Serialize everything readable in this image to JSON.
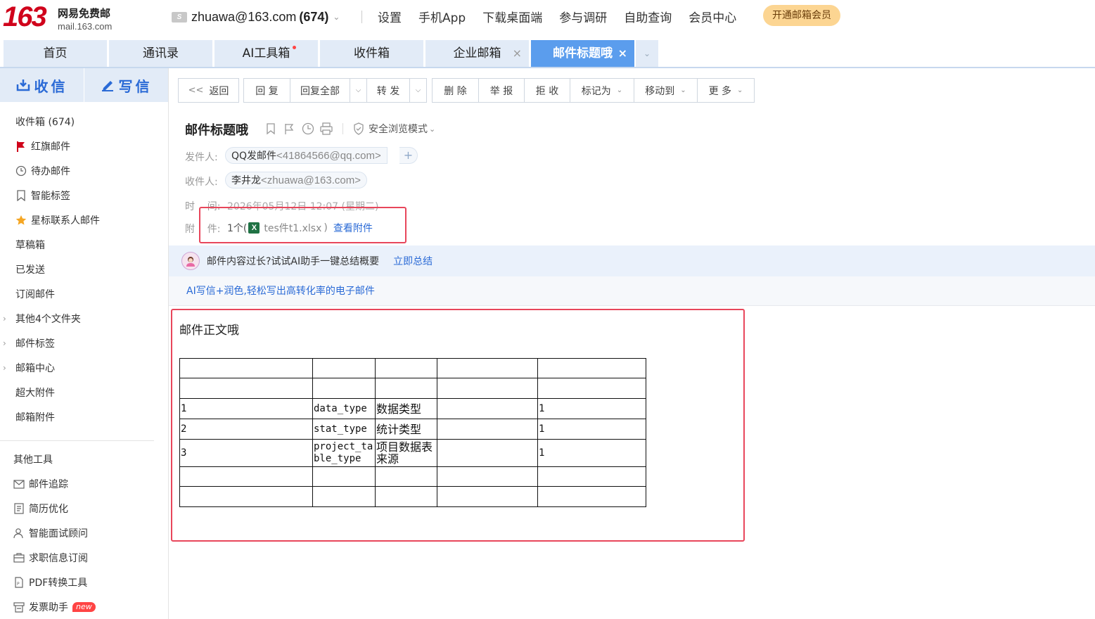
{
  "brand": {
    "logo_number": "163",
    "logo_cn": "网易免费邮",
    "logo_url": "mail.163.com"
  },
  "account": {
    "email": "zhuawa@163.com",
    "unread": "(674)"
  },
  "topnav": [
    "设置",
    "手机App",
    "下载桌面端",
    "参与调研",
    "自助查询",
    "会员中心"
  ],
  "vip_button": "开通邮箱会员",
  "tabs": [
    {
      "label": "首页"
    },
    {
      "label": "通讯录"
    },
    {
      "label": "AI工具箱"
    },
    {
      "label": "收件箱"
    },
    {
      "label": "企业邮箱"
    },
    {
      "label": "邮件标题哦"
    }
  ],
  "sidebar": {
    "receive": "收信",
    "compose": "写信",
    "folders": [
      {
        "label": "收件箱 (674)",
        "icon": "inbox"
      },
      {
        "label": "红旗邮件",
        "icon": "red-flag-icon"
      },
      {
        "label": "待办邮件",
        "icon": "clock-icon"
      },
      {
        "label": "智能标签",
        "icon": "bookmark-icon"
      },
      {
        "label": "星标联系人邮件",
        "icon": "star-icon"
      },
      {
        "label": "草稿箱"
      },
      {
        "label": "已发送"
      },
      {
        "label": "订阅邮件"
      },
      {
        "label": "其他4个文件夹",
        "icon": "expand-arrow"
      },
      {
        "label": "邮件标签",
        "icon": "expand-arrow"
      },
      {
        "label": "邮箱中心",
        "icon": "expand-arrow"
      },
      {
        "label": "超大附件"
      },
      {
        "label": "邮箱附件"
      }
    ],
    "tools_title": "其他工具",
    "tools": [
      {
        "label": "邮件追踪",
        "icon": "mail-track-icon"
      },
      {
        "label": "简历优化",
        "icon": "resume-icon"
      },
      {
        "label": "智能面试顾问",
        "icon": "interview-icon"
      },
      {
        "label": "求职信息订阅",
        "icon": "briefcase-icon"
      },
      {
        "label": "PDF转换工具",
        "icon": "pdf-icon"
      },
      {
        "label": "发票助手",
        "icon": "invoice-icon",
        "badge": "new"
      }
    ]
  },
  "toolbar": {
    "back": "返回",
    "reply": "回 复",
    "reply_all": "回复全部",
    "forward": "转 发",
    "delete": "删 除",
    "report": "举 报",
    "reject": "拒 收",
    "mark_as": "标记为",
    "move_to": "移动到",
    "more": "更 多"
  },
  "mail": {
    "subject": "邮件标题哦",
    "safe_mode": "安全浏览模式",
    "from_label": "发件人:",
    "from_name": "QQ发邮件",
    "from_addr": "<41864566@qq.com>",
    "to_label": "收件人:",
    "to_name": "李井龙",
    "to_addr": "<zhuawa@163.com>",
    "time_label": "时    间:",
    "time_value": "2026年05月12日 12:07 (星期二)",
    "attach_label": "附    件:",
    "attach_count": "1个(",
    "attach_name": "tes件t1.xlsx",
    "attach_close": ")",
    "attach_view": "查看附件"
  },
  "ai": {
    "banner_text": "邮件内容过长?试试AI助手一键总结概要",
    "banner_link": "立即总结",
    "banner2_text": "AI写信+润色,轻松写出高转化率的电子邮件"
  },
  "body": {
    "text": "邮件正文哦",
    "table": [
      [
        "",
        "",
        "",
        "",
        ""
      ],
      [
        "",
        "",
        "",
        "",
        ""
      ],
      [
        "1",
        "data_type",
        "数据类型",
        "",
        "1"
      ],
      [
        "2",
        "stat_type",
        "统计类型",
        "",
        "1"
      ],
      [
        "3",
        "project_table_type",
        "项目数据表来源",
        "",
        "1"
      ],
      [
        "",
        "",
        "",
        "",
        ""
      ],
      [
        "",
        "",
        "",
        "",
        ""
      ]
    ]
  }
}
